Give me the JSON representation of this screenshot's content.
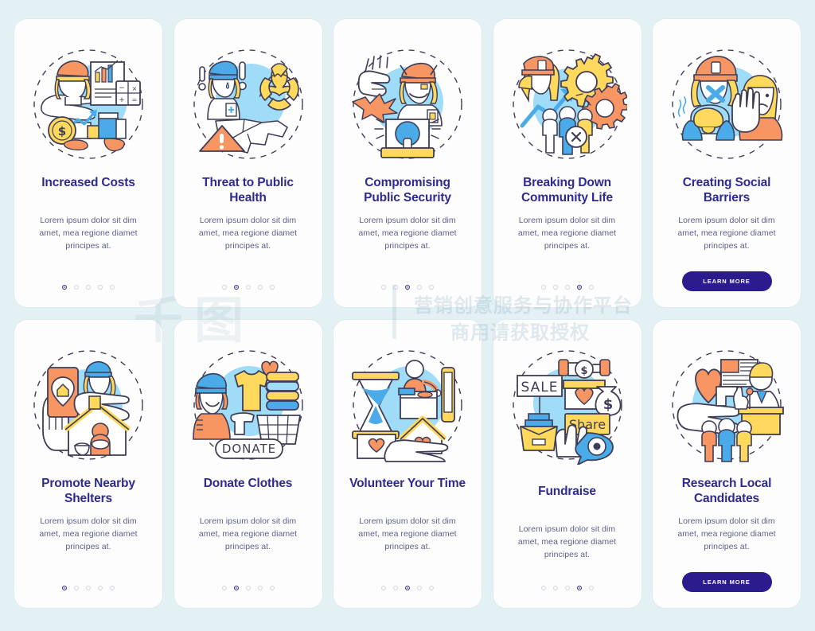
{
  "background_color": "#e3f0f4",
  "card_background": "#fdfdfd",
  "title_color": "#2f2a8f",
  "body_color": "#5b5f86",
  "accent_button_color": "#2b1b8c",
  "dot_active_color": "#3b3191",
  "dot_inactive_color": "#d2d4e0",
  "shared": {
    "description": "Lorem ipsum dolor sit dim amet, mea regione diamet principes at.",
    "cta_label": "LEARN MORE",
    "dot_count": 5
  },
  "watermark": {
    "logo": "千图",
    "line1": "营销创意服务与协作平台",
    "line2": "商用请获取授权"
  },
  "rows": [
    {
      "cards": [
        {
          "title": "Increased Costs",
          "illustration": "increased-costs-illustration",
          "description": "Lorem ipsum dolor sit dim amet, mea regione diamet principes at.",
          "active_dot": 1,
          "dot_count": 5,
          "has_cta": false,
          "cta_label": ""
        },
        {
          "title": "Threat to Public Health",
          "illustration": "threat-public-health-illustration",
          "description": "Lorem ipsum dolor sit dim amet, mea regione diamet principes at.",
          "active_dot": 2,
          "dot_count": 5,
          "has_cta": false,
          "cta_label": ""
        },
        {
          "title": "Compromising Public Security",
          "illustration": "compromising-public-security-illustration",
          "description": "Lorem ipsum dolor sit dim amet, mea regione diamet principes at.",
          "active_dot": 3,
          "dot_count": 5,
          "has_cta": false,
          "cta_label": ""
        },
        {
          "title": "Breaking Down Community Life",
          "illustration": "breaking-down-community-life-illustration",
          "description": "Lorem ipsum dolor sit dim amet, mea regione diamet principes at.",
          "active_dot": 4,
          "dot_count": 5,
          "has_cta": false,
          "cta_label": ""
        },
        {
          "title": "Creating Social Barriers",
          "illustration": "creating-social-barriers-illustration",
          "description": "Lorem ipsum dolor sit dim amet, mea regione diamet principes at.",
          "active_dot": 5,
          "dot_count": 5,
          "has_cta": true,
          "cta_label": "LEARN MORE"
        }
      ]
    },
    {
      "cards": [
        {
          "title": "Promote Nearby Shelters",
          "illustration": "promote-nearby-shelters-illustration",
          "description": "Lorem ipsum dolor sit dim amet, mea regione diamet principes at.",
          "active_dot": 1,
          "dot_count": 5,
          "has_cta": false,
          "cta_label": ""
        },
        {
          "title": "Donate Clothes",
          "illustration": "donate-clothes-illustration",
          "description": "Lorem ipsum dolor sit dim amet, mea regione diamet principes at.",
          "active_dot": 2,
          "dot_count": 5,
          "has_cta": false,
          "cta_label": ""
        },
        {
          "title": "Volunteer Your Time",
          "illustration": "volunteer-your-time-illustration",
          "description": "Lorem ipsum dolor sit dim amet, mea regione diamet principes at.",
          "active_dot": 3,
          "dot_count": 5,
          "has_cta": false,
          "cta_label": ""
        },
        {
          "title": "Fundraise",
          "illustration": "fundraise-illustration",
          "description": "Lorem ipsum dolor sit dim amet, mea regione diamet principes at.",
          "active_dot": 4,
          "dot_count": 5,
          "has_cta": false,
          "cta_label": ""
        },
        {
          "title": "Research Local Candidates",
          "illustration": "research-local-candidates-illustration",
          "description": "Lorem ipsum dolor sit dim amet, mea regione diamet principes at.",
          "active_dot": 5,
          "dot_count": 5,
          "has_cta": true,
          "cta_label": "LEARN MORE"
        }
      ]
    }
  ],
  "illustration_labels": {
    "donate_button": "DONATE",
    "sale_sign": "SALE",
    "share_sign": "Share",
    "dollar": "$"
  }
}
